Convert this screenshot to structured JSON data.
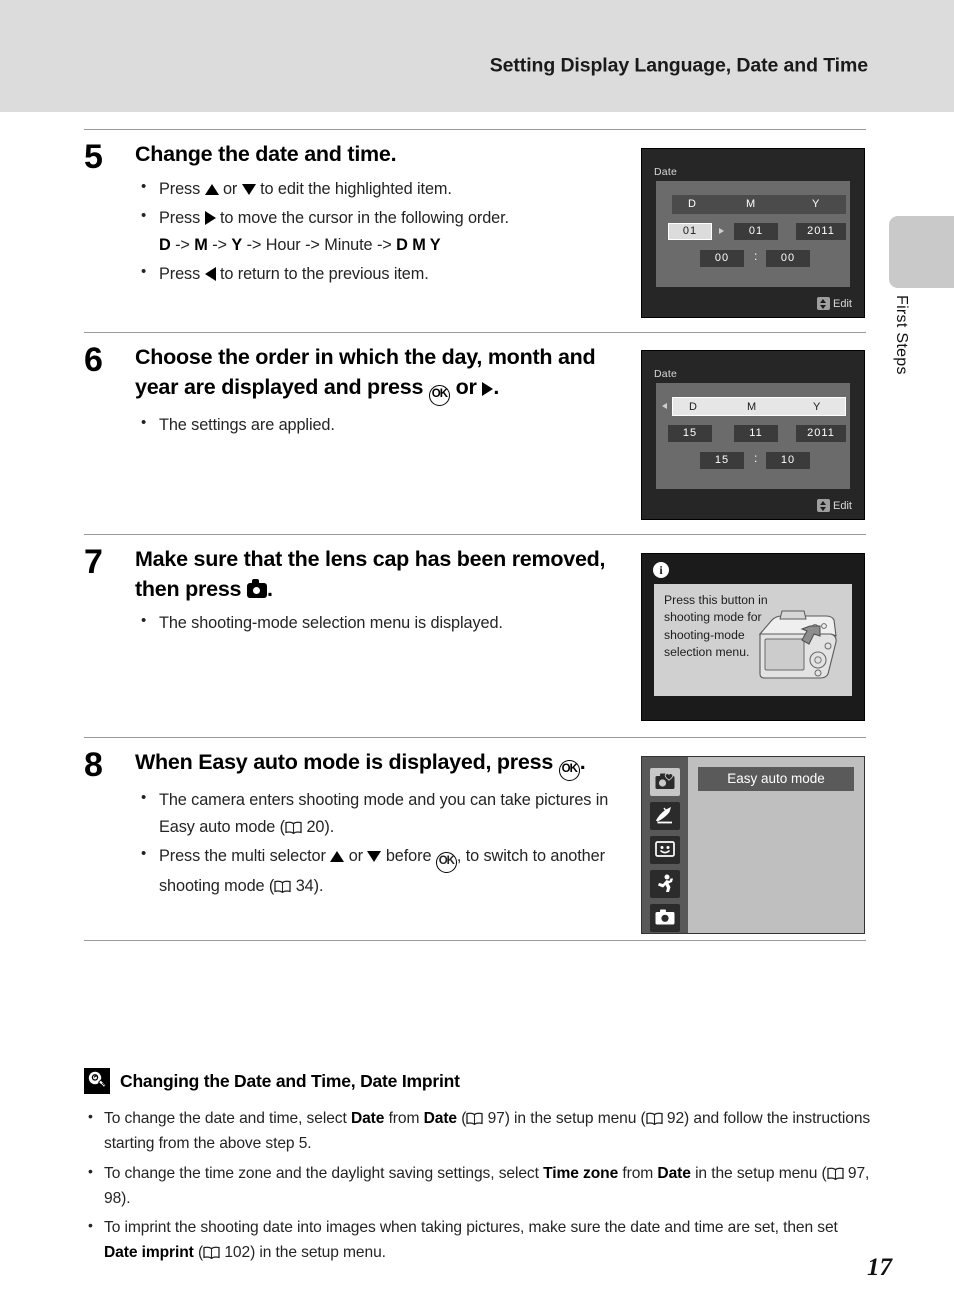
{
  "header": {
    "title": "Setting Display Language, Date and Time"
  },
  "side_tab": {
    "label": "First Steps"
  },
  "steps": [
    {
      "number": "5",
      "title": "Change the date and time.",
      "bullets": [
        "Press ▲ or ▼ to edit the highlighted item.",
        "Press ▶ to move the cursor in the following order. D -> M -> Y -> Hour -> Minute -> D M Y",
        "Press ◀ to return to the previous item."
      ],
      "order_line": {
        "d": "D",
        "m": "M",
        "y": "Y",
        "hour": "Hour",
        "minute": "Minute",
        "dmy": "D M Y",
        "arrow": "->"
      },
      "screen": {
        "type": "date-setting",
        "title": "Date",
        "columns": [
          "D",
          "M",
          "Y"
        ],
        "header_selected": false,
        "day": "01",
        "month": "01",
        "year": "2011",
        "hour": "00",
        "minute": "00",
        "separator": ":",
        "selected_field": "day",
        "hint_label": "Edit"
      }
    },
    {
      "number": "6",
      "title": "Choose the order in which the day, month and year are displayed and press Ⓞ or ▶.",
      "title_part1": "Choose the order in which the day, month and year are displayed and press",
      "title_part2": "or",
      "title_part3": ".",
      "bullets": [
        "The settings are applied."
      ],
      "screen": {
        "type": "date-setting",
        "title": "Date",
        "columns": [
          "D",
          "M",
          "Y"
        ],
        "header_selected": true,
        "day": "15",
        "month": "11",
        "year": "2011",
        "hour": "15",
        "minute": "10",
        "separator": ":",
        "selected_field": "header",
        "hint_label": "Edit"
      }
    },
    {
      "number": "7",
      "title_part1": "Make sure that the lens cap has been removed, then press",
      "title_part3": ".",
      "bullets": [
        "The shooting-mode selection menu is displayed."
      ],
      "screen": {
        "type": "info-message",
        "icon": "info-icon",
        "message": "Press this button in shooting mode for shooting-mode selection menu.",
        "illustration": "camera-rear-view"
      }
    },
    {
      "number": "8",
      "title_part1": "When",
      "title_bold": "Easy auto mode",
      "title_part2": "is displayed, press",
      "title_part3": ".",
      "bullets": [
        "The camera enters shooting mode and you can take pictures in Easy auto mode (□ 20).",
        "Press the multi selector ▲ or ▼ before Ⓞ, to switch to another shooting mode (□ 34)."
      ],
      "bullet1_pre": "The camera enters shooting mode and you can take pictures in Easy auto mode (",
      "bullet1_page": "20",
      "bullet1_post": ").",
      "bullet2_pre": "Press the multi selector",
      "bullet2_or": "or",
      "bullet2_before": "before",
      "bullet2_mid": ", to switch to another shooting mode (",
      "bullet2_page": "34",
      "bullet2_post": ").",
      "screen": {
        "type": "mode-selection",
        "selected_label": "Easy auto mode",
        "icons": [
          "easy-auto-mode-icon",
          "scene-auto-selector-icon",
          "smart-portrait-icon",
          "subject-tracking-icon",
          "auto-mode-icon"
        ],
        "selected_index": 0
      }
    }
  ],
  "note": {
    "icon": "lightbulb-icon",
    "title": "Changing the Date and Time, Date Imprint",
    "items": [
      {
        "pre": "To change the date and time, select",
        "bold1": "Date",
        "mid1": "from",
        "bold2": "Date",
        "page1": "97",
        "mid2": ") in the setup menu (",
        "page2": "92",
        "post": ") and follow the instructions starting from the above step 5."
      },
      {
        "pre": "To change the time zone and the daylight saving settings, select",
        "bold1": "Time zone",
        "mid1": "from",
        "bold2": "Date",
        "mid2": "in the setup menu (",
        "page1": "97, 98",
        "post": ")."
      },
      {
        "pre": "To imprint the shooting date into images when taking pictures, make sure the date and time are set, then set",
        "bold1": "Date imprint",
        "page1": "102",
        "post": ") in the setup menu."
      }
    ]
  },
  "page_number": "17"
}
